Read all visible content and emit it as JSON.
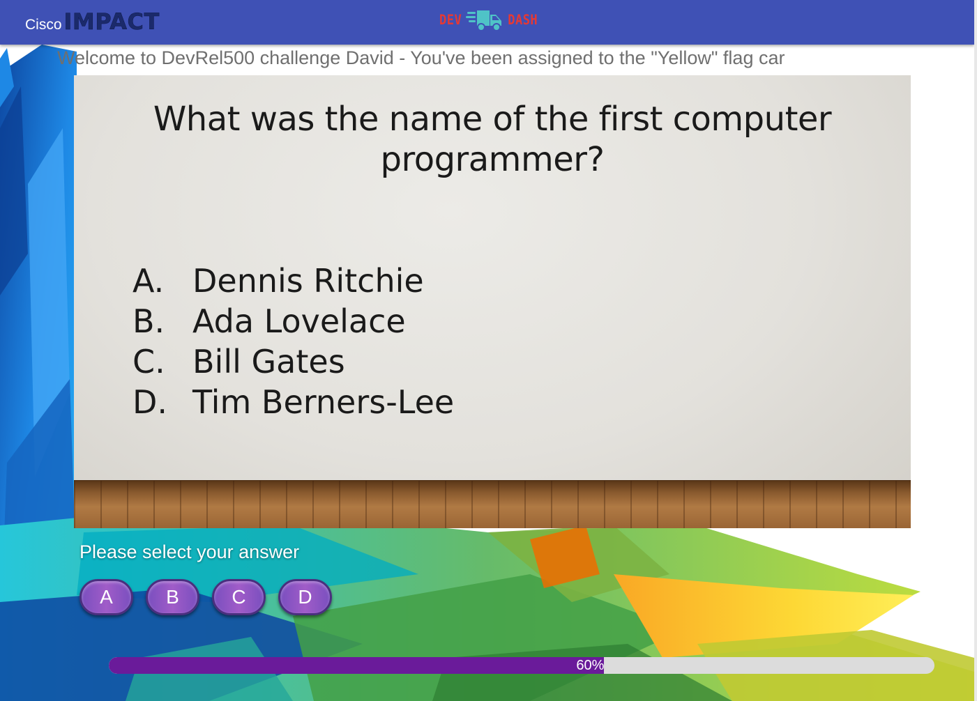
{
  "header": {
    "brand_prefix": "Cisco",
    "brand_name": "IMPACT",
    "logo": {
      "left_word": "DEV",
      "right_word": "DASH",
      "icon": "delivery-truck-icon",
      "colors": {
        "words": "#e53935",
        "truck": "#4fc3c7"
      }
    }
  },
  "welcome_text": "Welcome to DevRel500 challenge David - You've been assigned to the \"Yellow\" flag car",
  "slide": {
    "question_line1": "What was the name of the first computer",
    "question_line2": "programmer?",
    "options": [
      {
        "letter": "A.",
        "text": "Dennis Ritchie"
      },
      {
        "letter": "B.",
        "text": "Ada Lovelace"
      },
      {
        "letter": "C.",
        "text": "Bill Gates"
      },
      {
        "letter": "D.",
        "text": "Tim Berners-Lee"
      }
    ]
  },
  "answer_prompt": "Please select your answer",
  "answer_buttons": [
    "A",
    "B",
    "C",
    "D"
  ],
  "progress": {
    "value": 0.6,
    "label": "60%"
  },
  "colors": {
    "topbar": "#3f51b5",
    "progress_fill": "#6a1b9a",
    "progress_track": "#dcdcdc",
    "button": "#9b59c6"
  }
}
